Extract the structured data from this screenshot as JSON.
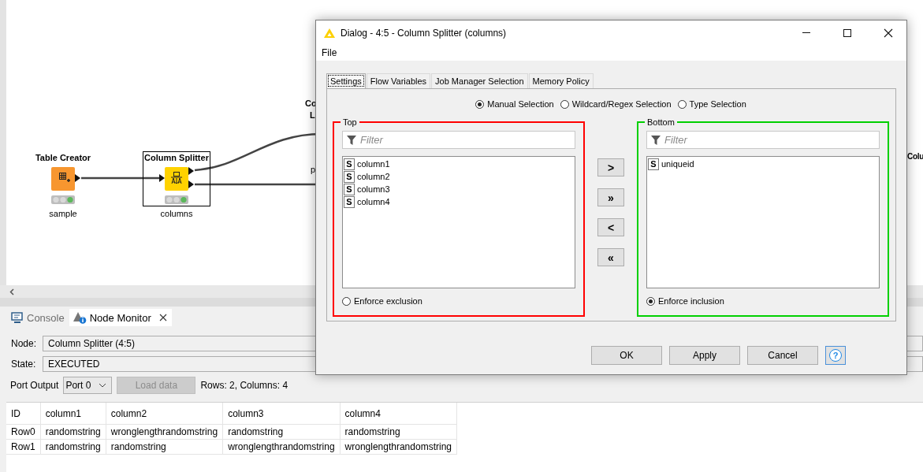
{
  "canvas": {
    "nodes": [
      {
        "title": "Table Creator",
        "label": "sample",
        "kind": "creator",
        "executed": true,
        "selected": false
      },
      {
        "title": "Column Splitter",
        "label": "columns",
        "kind": "splitter",
        "executed": true,
        "selected": true
      }
    ],
    "partial_labels": [
      "Co",
      "L",
      "p",
      "Colu"
    ]
  },
  "monitor": {
    "tabs": [
      {
        "label": "Console",
        "kind": "console",
        "selected": false
      },
      {
        "label": "Node Monitor",
        "kind": "monitor",
        "selected": true
      }
    ],
    "fields": [
      {
        "label": "Node:",
        "value": "Column Splitter  (4:5)"
      },
      {
        "label": "State:",
        "value": "EXECUTED"
      }
    ],
    "port_label": "Port Output",
    "port_select": "Port 0",
    "load_button": {
      "label": "Load data",
      "disabled": true
    },
    "summary": "Rows: 2, Columns: 4",
    "table": {
      "columns": [
        "ID",
        "column1",
        "column2",
        "column3",
        "column4"
      ],
      "rows": [
        [
          "Row0",
          "randomstring",
          "wronglengthrandomstring",
          "randomstring",
          "randomstring"
        ],
        [
          "Row1",
          "randomstring",
          "randomstring",
          "wronglengthrandomstring",
          "wronglengthrandomstring"
        ]
      ]
    }
  },
  "dialog": {
    "title": "Dialog - 4:5 - Column Splitter (columns)",
    "menu": [
      "File"
    ],
    "tabs": [
      {
        "label": "Settings",
        "selected": true
      },
      {
        "label": "Flow Variables",
        "selected": false
      },
      {
        "label": "Job Manager Selection",
        "selected": false
      },
      {
        "label": "Memory Policy",
        "selected": false
      }
    ],
    "modes": [
      {
        "label": "Manual Selection",
        "selected": true
      },
      {
        "label": "Wildcard/Regex Selection",
        "selected": false
      },
      {
        "label": "Type Selection",
        "selected": false
      }
    ],
    "panels": [
      {
        "title": "Top",
        "color": "#ff0000",
        "filter_placeholder": "Filter",
        "items": [
          {
            "type": "S",
            "name": "column1"
          },
          {
            "type": "S",
            "name": "column2"
          },
          {
            "type": "S",
            "name": "column3"
          },
          {
            "type": "S",
            "name": "column4"
          }
        ],
        "enforce": {
          "label": "Enforce exclusion",
          "selected": false
        }
      },
      {
        "title": "Bottom",
        "color": "#00d000",
        "filter_placeholder": "Filter",
        "items": [
          {
            "type": "S",
            "name": "uniqueid"
          }
        ],
        "enforce": {
          "label": "Enforce inclusion",
          "selected": true
        }
      }
    ],
    "move_buttons": [
      ">",
      "»",
      "<",
      "«"
    ],
    "buttons": [
      "OK",
      "Apply",
      "Cancel"
    ],
    "help": "?"
  }
}
